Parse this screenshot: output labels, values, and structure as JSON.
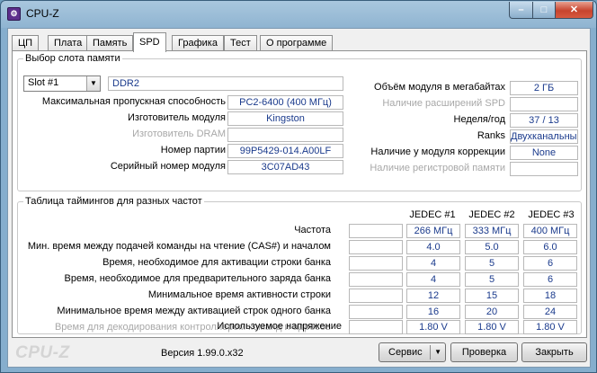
{
  "window": {
    "title": "CPU-Z",
    "icon": "cpuz-app-icon",
    "min_label": "–",
    "max_label": "□",
    "close_label": "✕"
  },
  "tabs": [
    {
      "label": "ЦП"
    },
    {
      "label": "Плата"
    },
    {
      "label": "Память"
    },
    {
      "label": "SPD"
    },
    {
      "label": "Графика"
    },
    {
      "label": "Тест"
    },
    {
      "label": "О программе"
    }
  ],
  "slot": {
    "group_title": "Выбор слота памяти",
    "selected": "Slot #1",
    "mem_type": "DDR2",
    "left_fields": [
      {
        "label": "Максимальная пропускная способность",
        "value": "PC2-6400 (400 МГц)",
        "enabled": true
      },
      {
        "label": "Изготовитель модуля",
        "value": "Kingston",
        "enabled": true
      },
      {
        "label": "Изготовитель DRAM",
        "value": "",
        "enabled": false
      },
      {
        "label": "Номер партии",
        "value": "99P5429-014.A00LF",
        "enabled": true
      },
      {
        "label": "Серийный номер модуля",
        "value": "3C07AD43",
        "enabled": true
      }
    ],
    "right_fields": [
      {
        "label": "Объём модуля в мегабайтах",
        "value": "2 ГБ",
        "enabled": true
      },
      {
        "label": "Наличие расширений SPD",
        "value": "",
        "enabled": false
      },
      {
        "label": "Неделя/год",
        "value": "37 / 13",
        "enabled": true
      },
      {
        "label": "Ranks",
        "value": "Двухканальный",
        "enabled": true
      },
      {
        "label": "Наличие у модуля коррекции",
        "value": "None",
        "enabled": true
      },
      {
        "label": "Наличие регистровой памяти",
        "value": "",
        "enabled": false
      }
    ]
  },
  "timings": {
    "group_title": "Таблица таймингов для разных частот",
    "columns": [
      "JEDEC #1",
      "JEDEC #2",
      "JEDEC #3"
    ],
    "rows": [
      {
        "label": "Частота",
        "enabled": true,
        "values": [
          "266 МГц",
          "333 МГц",
          "400 МГц"
        ]
      },
      {
        "label": "Мин. время между подачей команды на чтение (CAS#) и началом",
        "enabled": true,
        "values": [
          "4.0",
          "5.0",
          "6.0"
        ]
      },
      {
        "label": "Время, необходимое для активации строки банка",
        "enabled": true,
        "values": [
          "4",
          "5",
          "6"
        ]
      },
      {
        "label": "Время, необходимое для предварительного заряда банка",
        "enabled": true,
        "values": [
          "4",
          "5",
          "6"
        ]
      },
      {
        "label": "Минимальное время активности строки",
        "enabled": true,
        "values": [
          "12",
          "15",
          "18"
        ]
      },
      {
        "label": "Минимальное время между активацией строк одного банка",
        "enabled": true,
        "values": [
          "16",
          "20",
          "24"
        ]
      },
      {
        "label": "Время для декодирования контроллером команд и адресов",
        "enabled": false,
        "values": [
          "",
          "",
          ""
        ]
      },
      {
        "label": "Используемое напряжение",
        "enabled": true,
        "values": [
          "1.80 V",
          "1.80 V",
          "1.80 V"
        ]
      }
    ]
  },
  "footer": {
    "brand": "CPU-Z",
    "version": "Версия 1.99.0.x32",
    "service_label": "Сервис",
    "check_label": "Проверка",
    "close_label": "Закрыть"
  }
}
